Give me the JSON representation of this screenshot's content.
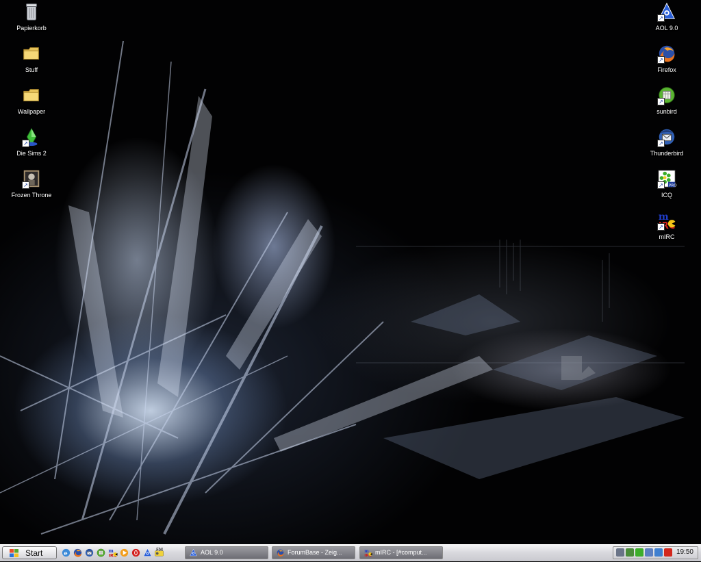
{
  "desktop": {
    "left_icons": [
      {
        "label": "Papierkorb",
        "icon": "recycle-bin-icon"
      },
      {
        "label": "Stuff",
        "icon": "folder-icon"
      },
      {
        "label": "Wallpaper",
        "icon": "folder-icon"
      },
      {
        "label": "Die Sims 2",
        "icon": "sims2-icon"
      },
      {
        "label": "Frozen Throne",
        "icon": "frozen-throne-icon"
      }
    ],
    "right_icons": [
      {
        "label": "AOL 9.0",
        "icon": "aol-icon"
      },
      {
        "label": "Firefox",
        "icon": "firefox-icon"
      },
      {
        "label": "sunbird",
        "icon": "sunbird-icon"
      },
      {
        "label": "Thunderbird",
        "icon": "thunderbird-icon"
      },
      {
        "label": "ICQ",
        "icon": "icq-icon"
      },
      {
        "label": "mIRC",
        "icon": "mirc-icon"
      }
    ]
  },
  "taskbar": {
    "start_label": "Start",
    "quick_launch": [
      {
        "icon": "ie-icon"
      },
      {
        "icon": "firefox-icon"
      },
      {
        "icon": "thunderbird-icon"
      },
      {
        "icon": "sunbird-icon"
      },
      {
        "icon": "mirc-icon"
      },
      {
        "icon": "media-player-icon"
      },
      {
        "icon": "opera-icon"
      },
      {
        "icon": "aol-icon"
      },
      {
        "icon": "fm-radio-icon",
        "label": "FM"
      }
    ],
    "tasks": [
      {
        "label": "AOL 9.0",
        "icon": "aol-icon"
      },
      {
        "label": "ForumBase - Zeig...",
        "icon": "firefox-icon"
      },
      {
        "label": "mIRC - [#comput...",
        "icon": "mirc-icon"
      }
    ],
    "tray_icons": [
      "display-icon",
      "network-icon",
      "icq-tray-icon",
      "volume-icon",
      "image-icon",
      "antivirus-icon"
    ],
    "clock": "19:50"
  }
}
